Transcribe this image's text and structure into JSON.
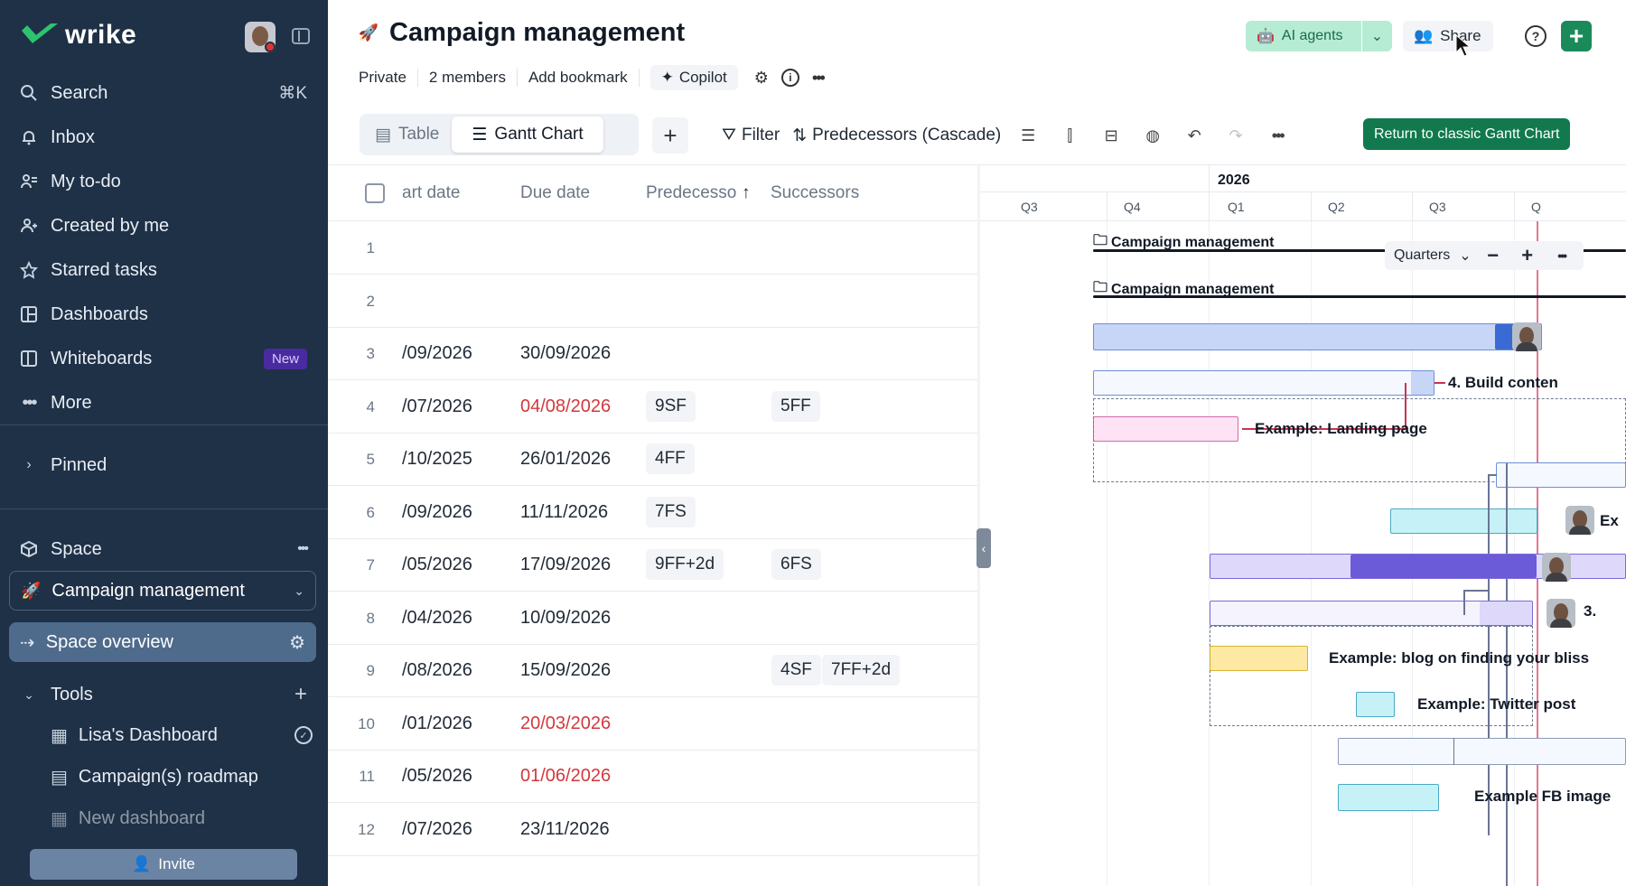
{
  "sidebar": {
    "brand": "wrike",
    "nav": [
      {
        "label": "Search",
        "kbd": "⌘K",
        "icon": "search-icon"
      },
      {
        "label": "Inbox",
        "icon": "bell-icon"
      },
      {
        "label": "My to-do",
        "icon": "todo-icon"
      },
      {
        "label": "Created by me",
        "icon": "user-plus-icon"
      },
      {
        "label": "Starred tasks",
        "icon": "star-icon"
      },
      {
        "label": "Dashboards",
        "icon": "dashboard-icon"
      },
      {
        "label": "Whiteboards",
        "badge": "New",
        "icon": "whiteboard-icon"
      },
      {
        "label": "More",
        "icon": "more-icon"
      }
    ],
    "pinned": "Pinned",
    "space_section": "Space",
    "space_selected": "Campaign management",
    "space_overview": "Space overview",
    "tools": "Tools",
    "tool_items": [
      "Lisa's Dashboard",
      "Campaign(s) roadmap",
      "New dashboard"
    ],
    "invite": "Invite"
  },
  "header": {
    "title": "Campaign management",
    "meta": [
      "Private",
      "2 members",
      "Add bookmark"
    ],
    "copilot": "Copilot",
    "ai_agents": "AI agents",
    "share": "Share",
    "help": "?"
  },
  "toolbar": {
    "tabs": [
      {
        "label": "Table",
        "icon": "table-icon",
        "active": false
      },
      {
        "label": "Gantt Chart",
        "icon": "gantt-icon",
        "active": true
      }
    ],
    "filter": "Filter",
    "sort": "Predecessors (Cascade)",
    "return_label": "Return to classic Gantt Chart"
  },
  "table": {
    "columns": {
      "start": "art date",
      "due": "Due date",
      "pred": "Predecesso",
      "succ": "Successors"
    },
    "rows": [
      {
        "n": "1",
        "start": "",
        "due": "",
        "due_late": false,
        "pred": [],
        "succ": []
      },
      {
        "n": "2",
        "start": "",
        "due": "",
        "due_late": false,
        "pred": [],
        "succ": []
      },
      {
        "n": "3",
        "start": "/09/2026",
        "due": "30/09/2026",
        "due_late": false,
        "pred": [],
        "succ": []
      },
      {
        "n": "4",
        "start": "/07/2026",
        "due": "04/08/2026",
        "due_late": true,
        "pred": [
          "9SF"
        ],
        "succ": [
          "5FF"
        ]
      },
      {
        "n": "5",
        "start": "/10/2025",
        "due": "26/01/2026",
        "due_late": false,
        "pred": [
          "4FF"
        ],
        "succ": []
      },
      {
        "n": "6",
        "start": "/09/2026",
        "due": "11/11/2026",
        "due_late": false,
        "pred": [
          "7FS"
        ],
        "succ": []
      },
      {
        "n": "7",
        "start": "/05/2026",
        "due": "17/09/2026",
        "due_late": false,
        "pred": [
          "9FF+2d"
        ],
        "succ": [
          "6FS"
        ]
      },
      {
        "n": "8",
        "start": "/04/2026",
        "due": "10/09/2026",
        "due_late": false,
        "pred": [],
        "succ": []
      },
      {
        "n": "9",
        "start": "/08/2026",
        "due": "15/09/2026",
        "due_late": false,
        "pred": [],
        "succ": [
          "4SF",
          "7FF+2d"
        ]
      },
      {
        "n": "10",
        "start": "/01/2026",
        "due": "20/03/2026",
        "due_late": true,
        "pred": [],
        "succ": []
      },
      {
        "n": "11",
        "start": "/05/2026",
        "due": "01/06/2026",
        "due_late": true,
        "pred": [],
        "succ": []
      },
      {
        "n": "12",
        "start": "/07/2026",
        "due": "23/11/2026",
        "due_late": false,
        "pred": [],
        "succ": []
      }
    ]
  },
  "gantt": {
    "year": "2026",
    "quarters": [
      "Q3",
      "Q4",
      "Q1",
      "Q2",
      "Q3",
      "Q"
    ],
    "scale": "Quarters",
    "groups": [
      "Campaign management",
      "Campaign management"
    ],
    "labels": {
      "build": "4. Build conten",
      "landing": "Example: Landing page",
      "ex7": "Ex",
      "r9": "3.",
      "blog": "Example: blog on finding your bliss",
      "twitter": "Example: Twitter post",
      "fb": "Example FB image"
    },
    "colors": {
      "blue": "#c7d6f6",
      "purple": "#6b5bd8",
      "pink": "#fde3f3",
      "cyan": "#c6f2f7",
      "yellow": "#fde9a3"
    }
  }
}
